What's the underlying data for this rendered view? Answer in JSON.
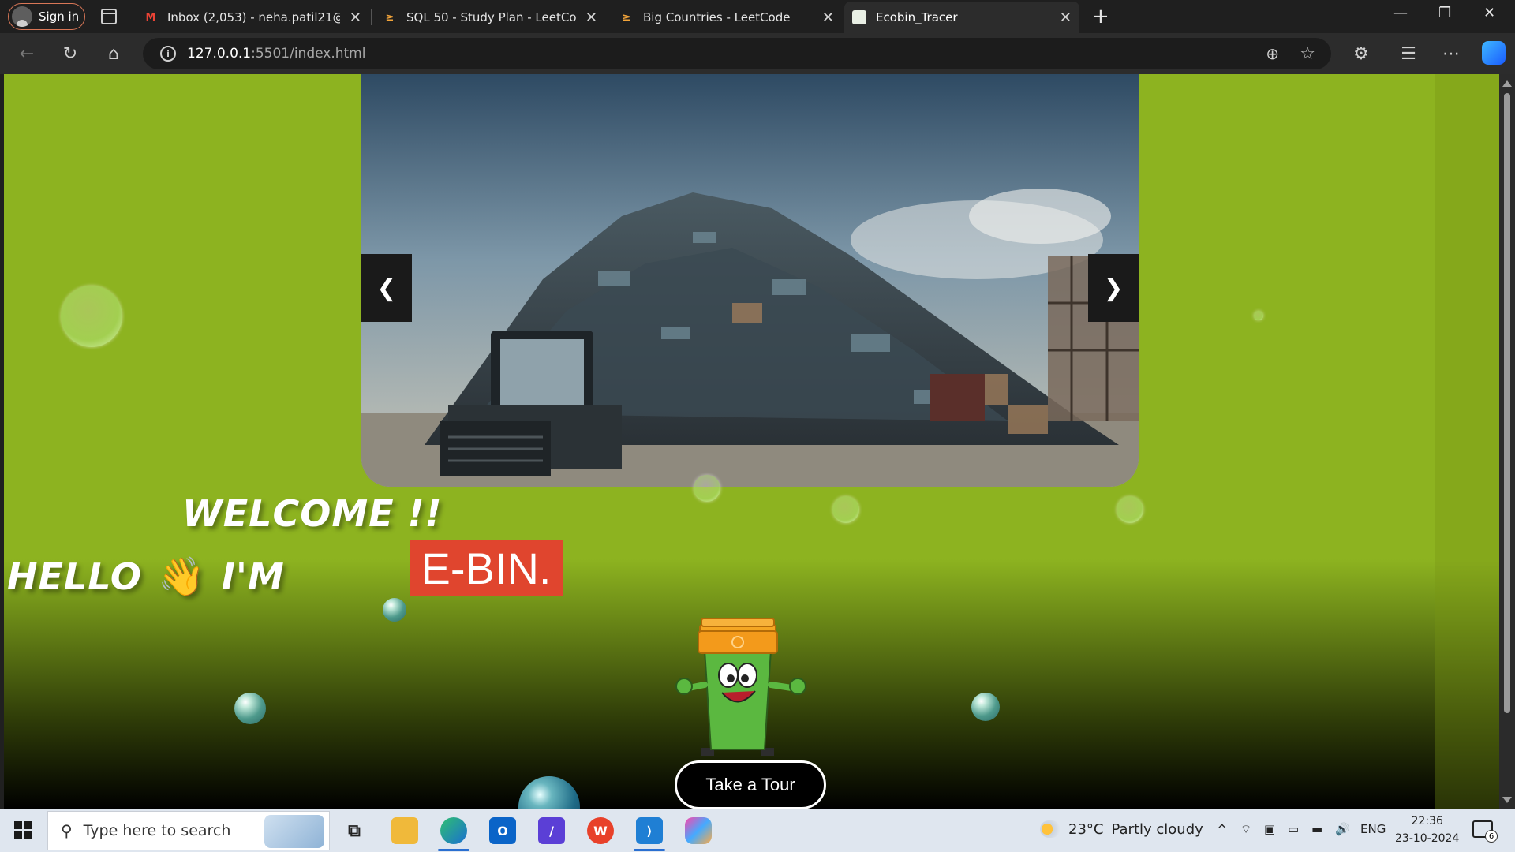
{
  "browser": {
    "profile_label": "Sign in",
    "tabs": [
      {
        "title": "Inbox (2,053) - neha.patil21@pccoe",
        "favicon": "gmail-icon"
      },
      {
        "title": "SQL 50 - Study Plan - LeetCode",
        "favicon": "leetcode-icon"
      },
      {
        "title": "Big Countries - LeetCode",
        "favicon": "leetcode-icon"
      },
      {
        "title": "Ecobin_Tracer",
        "favicon": "page-icon",
        "active": true
      }
    ],
    "address": {
      "host": "127.0.0.1",
      "path": ":5501/index.html"
    }
  },
  "page": {
    "carousel": {
      "prev_label": "❮",
      "next_label": "❯"
    },
    "welcome_text": "WELCOME !!",
    "hello_text": "HELLO",
    "wave_emoji": "👋",
    "im_text": "I'M",
    "brand_text": "E-BIN.",
    "tour_button": "Take a Tour",
    "colors": {
      "background": "#8db320",
      "brand_box": "#e0452e"
    }
  },
  "taskbar": {
    "search_placeholder": "Type here to search",
    "weather": {
      "temp": "23°C",
      "condition": "Partly cloudy"
    },
    "language": "ENG",
    "time": "22:36",
    "date": "23-10-2024",
    "notification_count": "6"
  }
}
